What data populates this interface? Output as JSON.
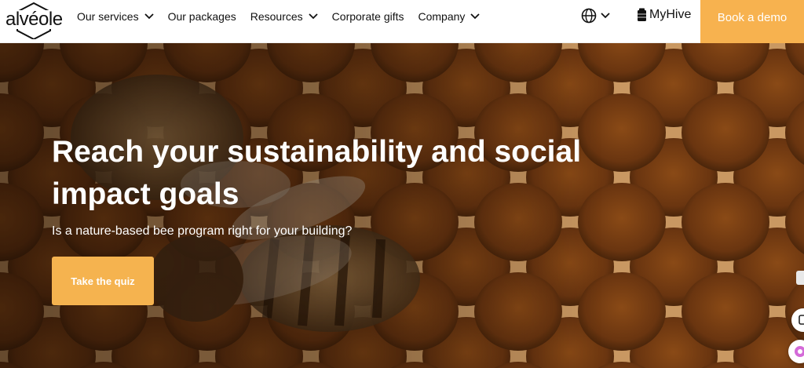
{
  "logo": {
    "text": "alvéole"
  },
  "nav": {
    "items": [
      {
        "label": "Our services",
        "has_dropdown": true
      },
      {
        "label": "Our packages",
        "has_dropdown": false
      },
      {
        "label": "Resources",
        "has_dropdown": true
      },
      {
        "label": "Corporate gifts",
        "has_dropdown": false
      },
      {
        "label": "Company",
        "has_dropdown": true
      }
    ],
    "language_icon": "globe-icon",
    "myhive_label": "MyHive",
    "demo_label": "Book a demo"
  },
  "hero": {
    "title": "Reach your sustainability and social impact goals",
    "subtitle": "Is a nature-based bee program right for your building?",
    "cta_label": "Take the quiz"
  },
  "colors": {
    "accent": "#f7b24f",
    "header_bg": "#ffffff",
    "text_dark": "#111111",
    "hero_text": "#ffffff"
  }
}
